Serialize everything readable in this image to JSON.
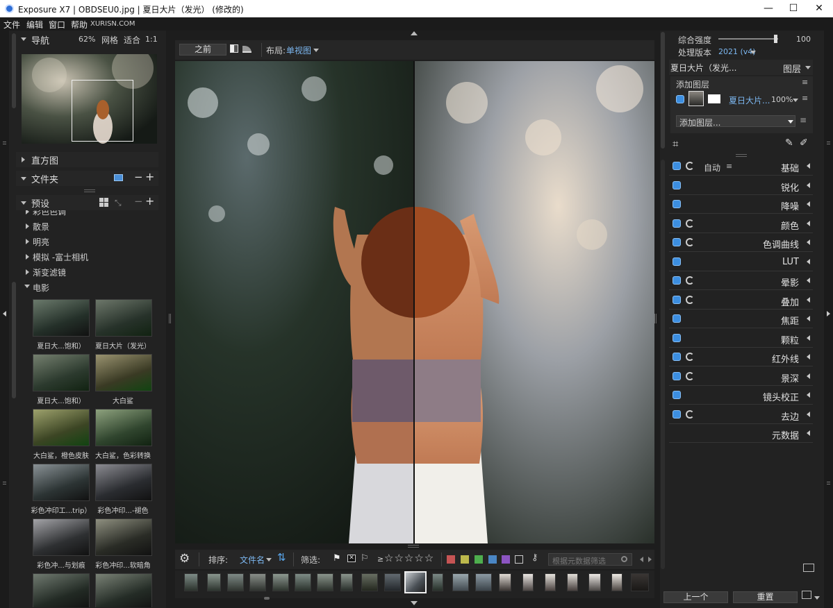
{
  "window": {
    "title": "Exposure X7 | OBDSEU0.jpg | 夏日大片（发光） (修改的)",
    "controls": [
      "—",
      "☐",
      "✕"
    ]
  },
  "menu": {
    "items": [
      "文件",
      "编辑",
      "窗口",
      "帮助"
    ],
    "brand": "XURISN.COM"
  },
  "navigator": {
    "title": "导航",
    "zoom": "62%",
    "grid": "网格",
    "fit": "适合",
    "one_to_one": "1:1"
  },
  "histogram": {
    "title": "直方图"
  },
  "folders": {
    "title": "文件夹"
  },
  "presets": {
    "title": "预设",
    "categories": [
      "彩色色调",
      "散景",
      "明亮",
      "模拟 -富士相机",
      "渐变滤镜",
      "电影"
    ],
    "thumbnails": [
      [
        "夏日大...饱和）",
        "夏日大片（发光）"
      ],
      [
        "夏日大...饱和）",
        "大白鲨"
      ],
      [
        "大白鲨，橙色皮肤",
        "大白鲨，色彩转换"
      ],
      [
        "彩色冲印工...trip）",
        "彩色冲印...-褪色"
      ],
      [
        "彩色冲...与划痕",
        "彩色冲印...软暗角"
      ]
    ]
  },
  "toolbar": {
    "before": "之前",
    "layout_label": "布局:",
    "layout_value": "单视图"
  },
  "filmstrip_bar": {
    "sort_label": "排序:",
    "sort_value": "文件名",
    "filter_label": "筛选:",
    "rating_prefix": "≥",
    "search_placeholder": "根据元数据筛选",
    "color_labels": [
      "#c65454",
      "#bcb84c",
      "#4eae4e",
      "#4a86c4",
      "#8c55c2"
    ]
  },
  "right_panel": {
    "intensity_label": "综合强度",
    "intensity_value": "100",
    "intensity_level": 1.0,
    "process_label": "处理版本",
    "process_value": "2021 (v4)",
    "layers_preset": "夏日大片（发光...",
    "layers_title": "图层",
    "add_layer": "添加图层",
    "layer_name": "夏日大片...",
    "layer_opacity": "100%",
    "add_layer_dropdown": "添加图层...",
    "auto_label": "自动",
    "adjustments": [
      {
        "label": "基础",
        "reset": true
      },
      {
        "label": "锐化",
        "reset": false
      },
      {
        "label": "降噪",
        "reset": false
      },
      {
        "label": "颜色",
        "reset": true
      },
      {
        "label": "色调曲线",
        "reset": true
      },
      {
        "label": "LUT",
        "reset": false
      },
      {
        "label": "晕影",
        "reset": true
      },
      {
        "label": "叠加",
        "reset": true
      },
      {
        "label": "焦距",
        "reset": false
      },
      {
        "label": "颗粒",
        "reset": false
      },
      {
        "label": "红外线",
        "reset": true
      },
      {
        "label": "景深",
        "reset": true
      },
      {
        "label": "镜头校正",
        "reset": false
      },
      {
        "label": "去边",
        "reset": true
      }
    ],
    "metadata": "元数据",
    "prev_button": "上一个",
    "reset_button": "重置"
  }
}
